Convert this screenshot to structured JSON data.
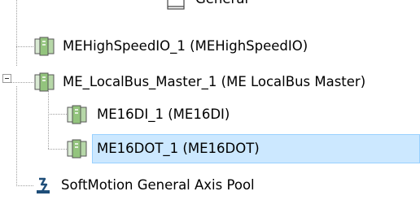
{
  "tree": {
    "items": [
      {
        "label": "General",
        "icon": "page-icon",
        "state": "partially-hidden"
      },
      {
        "label": "MEHighSpeedIO_1 (MEHighSpeedIO)",
        "icon": "io-module-icon"
      },
      {
        "label": "ME_LocalBus_Master_1 (ME LocalBus Master)",
        "icon": "io-module-icon",
        "expanded": true
      },
      {
        "label": "ME16DI_1 (ME16DI)",
        "icon": "io-module-icon"
      },
      {
        "label": "ME16DOT_1 (ME16DOT)",
        "icon": "io-module-icon",
        "selected": true
      },
      {
        "label": "SoftMotion General Axis Pool",
        "icon": "axis-pool-icon"
      }
    ],
    "selection_color": "#cce8ff",
    "selection_border": "#99d1ff",
    "icon_color": "#6aa84f"
  }
}
